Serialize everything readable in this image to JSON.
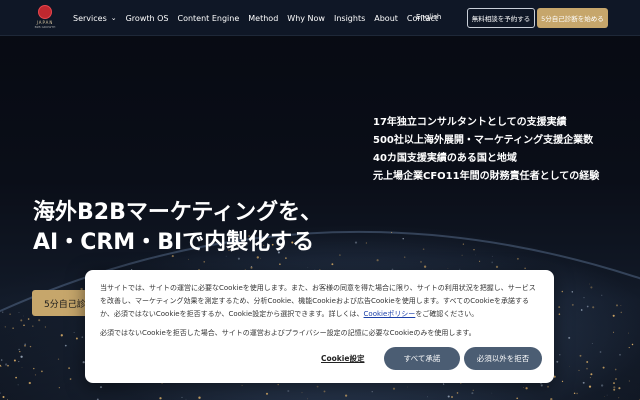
{
  "nav": {
    "logo_text": "JAPAN",
    "logo_subtext": "B2B GROWTH",
    "items": [
      {
        "label": "Services",
        "has_dropdown": true
      },
      {
        "label": "Growth OS"
      },
      {
        "label": "Content Engine"
      },
      {
        "label": "Method"
      },
      {
        "label": "Why Now"
      },
      {
        "label": "Insights"
      },
      {
        "label": "About"
      },
      {
        "label": "Contact"
      }
    ],
    "language": "English",
    "consult_button": "無料相談を予約する",
    "diagnosis_button": "5分自己診断を始める"
  },
  "hero": {
    "achievements": [
      "17年独立コンサルタントとしての支援実績",
      "500社以上海外展開・マーケティング支援企業数",
      "40カ国支援実績のある国と地域",
      "元上場企業CFO11年間の財務責任者としての経験"
    ],
    "headline_line1": "海外B2Bマーケティングを、",
    "headline_line2": "AI・CRM・BIで内製化する",
    "cta_label": "5分自己診断を始める"
  },
  "cookie_banner": {
    "text_part1": "当サイトでは、サイトの運営に必要なCookieを使用します。また、お客様の同意を得た場合に限り、サイトの利用状況を把握し、サービスを改善し、マーケティング効果を測定するため、分析Cookie、機能Cookieおよび広告Cookieを使用します。すべてのCookieを承諾するか、必須ではないCookieを拒否するか、Cookie設定から選択できます。詳しくは、",
    "policy_link": "Cookieポリシー",
    "text_part2": "をご確認ください。",
    "text_line2": "必須ではないCookieを拒否した場合、サイトの運営およびプライバシー設定の記憶に必要なCookieのみを使用します。",
    "settings_link": "Cookie設定",
    "accept_all": "すべて承諾",
    "reject_optional": "必須以外を拒否"
  },
  "colors": {
    "nav_bg": "#0f1726",
    "gold": "#c6a66b",
    "cookie_button": "#4b5d73",
    "link": "#1a3fa8"
  }
}
